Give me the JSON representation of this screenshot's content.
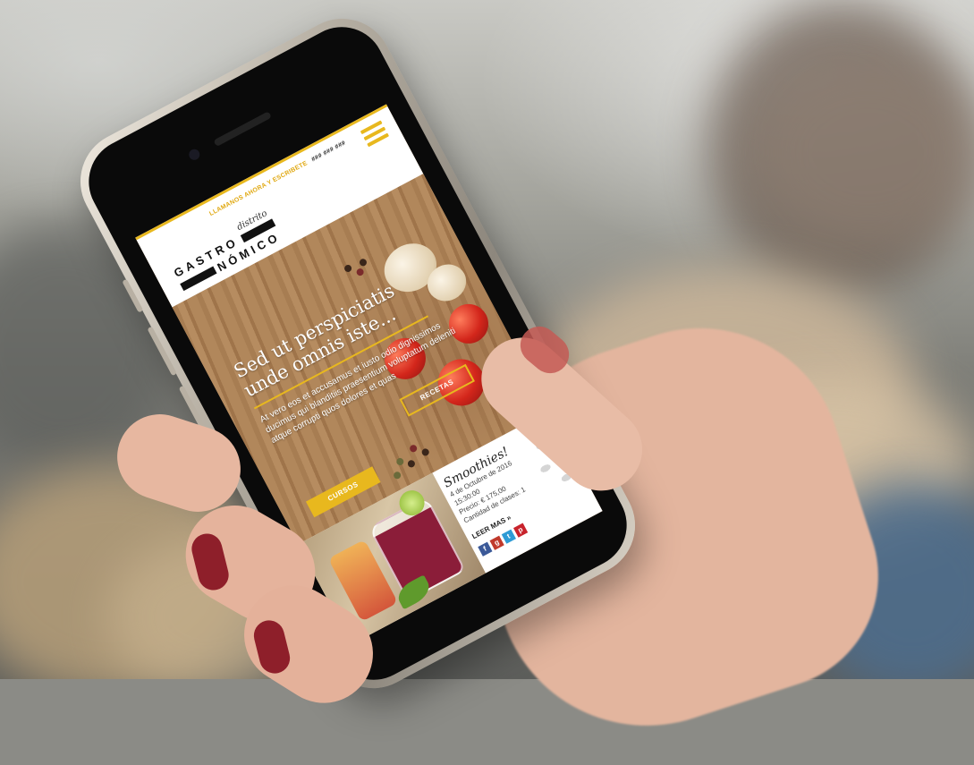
{
  "site": {
    "call_text": "LLAMANOS AHORA Y ESCRIBETE",
    "call_phone": "### ### ###",
    "logo_script": "distrito",
    "logo_line1": "GASTRO",
    "logo_line2": "NÓMICO"
  },
  "hero": {
    "title_line1": "Sed ut perspiciatis",
    "title_line2": "unde omnis iste...",
    "text": "At vero eos et accusamus et iusto odio dignissimos ducimus qui blanditiis praesentium voluptatum deleniti atque corrupti quos dolores et quas",
    "btn_recetas": "RECETAS",
    "btn_cursos": "CURSOS"
  },
  "card": {
    "title": "Smoothies!",
    "line1": "4 de Octubre de 2016",
    "line2": "15:30:00",
    "line3": "Precio: € 175,00",
    "line4": "Cantidad de clases: 1",
    "more": "LEER MAS »",
    "social_fb": "f",
    "social_gp": "g",
    "social_tw": "t",
    "social_pi": "p"
  },
  "colors": {
    "accent": "#e8b81e"
  }
}
